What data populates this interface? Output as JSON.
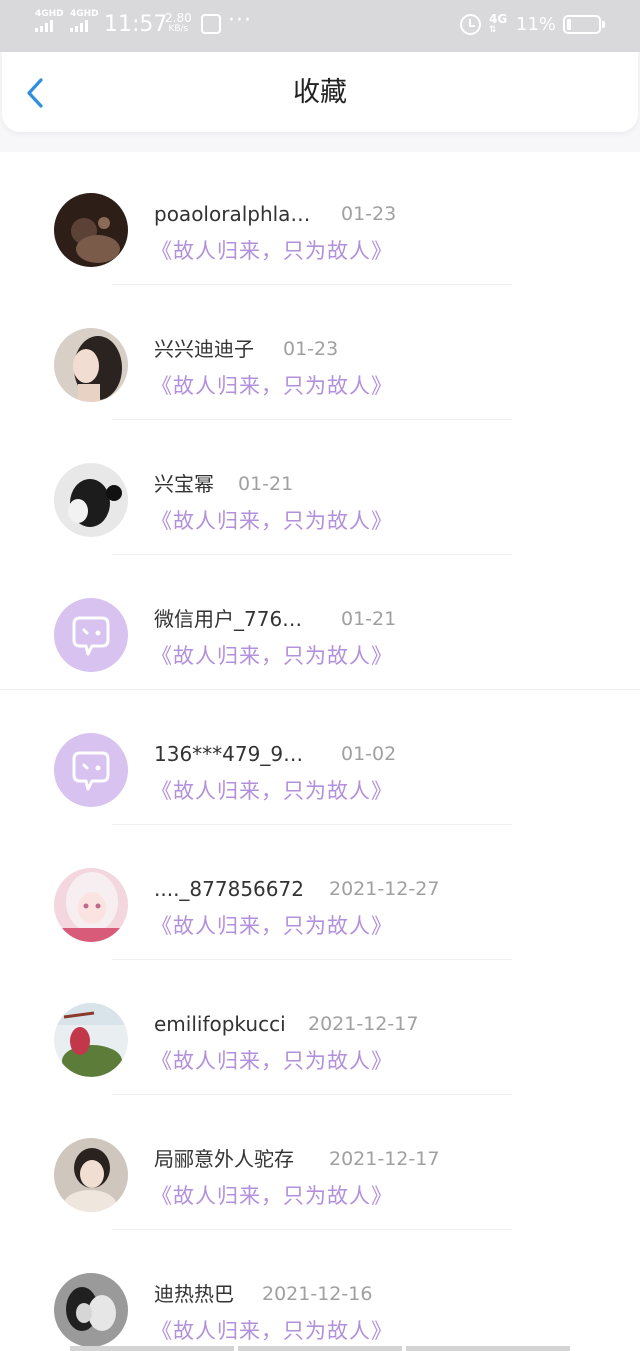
{
  "status_bar": {
    "sim1": "4GHD",
    "sim2": "4GHD",
    "time": "11:57",
    "speed_value": "2.80",
    "speed_unit": "KB/s",
    "more": "···",
    "network": "4G",
    "battery": "11%"
  },
  "nav": {
    "title": "收藏",
    "back_icon": "chevron-left-icon"
  },
  "colors": {
    "accent_blue": "#2e8fe0",
    "quote_purple": "#b290dc",
    "wechat_avatar_bg": "#d7c2f0"
  },
  "favorites": [
    {
      "name": "poaoloralphla…",
      "date": "01-23",
      "quote": "《故人归来，只为故人》",
      "avatar": "photo"
    },
    {
      "name": "兴兴迪迪子",
      "date": "01-23",
      "quote": "《故人归来，只为故人》",
      "avatar": "photo"
    },
    {
      "name": "兴宝幂",
      "date": "01-21",
      "quote": "《故人归来，只为故人》",
      "avatar": "photo"
    },
    {
      "name": "微信用户_776…",
      "date": "01-21",
      "quote": "《故人归来，只为故人》",
      "avatar": "default-chat-icon"
    },
    {
      "name": "136***479_9…",
      "date": "01-02",
      "quote": "《故人归来，只为故人》",
      "avatar": "default-chat-icon"
    },
    {
      "name": "...._877856672",
      "date": "2021-12-27",
      "quote": "《故人归来，只为故人》",
      "avatar": "photo"
    },
    {
      "name": "emilifopkucci",
      "date": "2021-12-17",
      "quote": "《故人归来，只为故人》",
      "avatar": "photo"
    },
    {
      "name": "局郦意外人驼存",
      "date": "2021-12-17",
      "quote": "《故人归来，只为故人》",
      "avatar": "photo"
    },
    {
      "name": "迪热热巴",
      "date": "2021-12-16",
      "quote": "《故人归来，只为故人》",
      "avatar": "photo"
    }
  ]
}
